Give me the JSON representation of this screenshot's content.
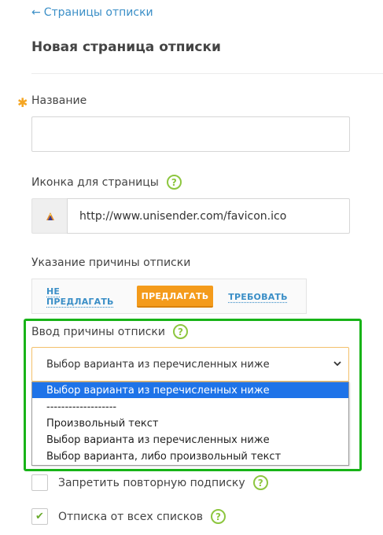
{
  "header": {
    "back_link": "Страницы отписки",
    "title": "Новая страница отписки"
  },
  "form": {
    "name_label": "Название",
    "name_value": "",
    "icon_label": "Иконка для страницы",
    "icon_url": "http://www.unisender.com/favicon.ico",
    "reason_label": "Указание причины отписки",
    "reason_options": [
      "НЕ ПРЕДЛАГАТЬ",
      "ПРЕДЛАГАТЬ",
      "ТРЕБОВАТЬ"
    ],
    "reason_selected": "ПРЕДЛАГАТЬ",
    "reason_input_label": "Ввод причины отписки",
    "reason_input_selected": "Выбор варианта из перечисленных ниже",
    "reason_input_options": [
      "Выбор варианта из перечисленных ниже",
      "-------------------",
      "Произвольный текст",
      "Выбор варианта из перечисленных ниже",
      "Выбор варианта, либо произвольный текст"
    ],
    "forbid_resubscribe_label": "Запретить повторную подписку",
    "forbid_resubscribe_checked": false,
    "unsubscribe_all_label": "Отписка от всех списков",
    "unsubscribe_all_checked": true,
    "help_glyph": "?"
  },
  "colors": {
    "accent_orange": "#f49b1b",
    "link_blue": "#3b8fc7",
    "help_green": "#8dc63f",
    "highlight_green": "#18b318",
    "dropdown_selected": "#1e73e8"
  },
  "icons": {
    "back": "arrow-left-icon",
    "help": "question-circle-icon",
    "favicon": "favicon-icon",
    "dropdown": "chevron-down-icon",
    "required": "asterisk-icon",
    "check": "checkmark-icon"
  }
}
